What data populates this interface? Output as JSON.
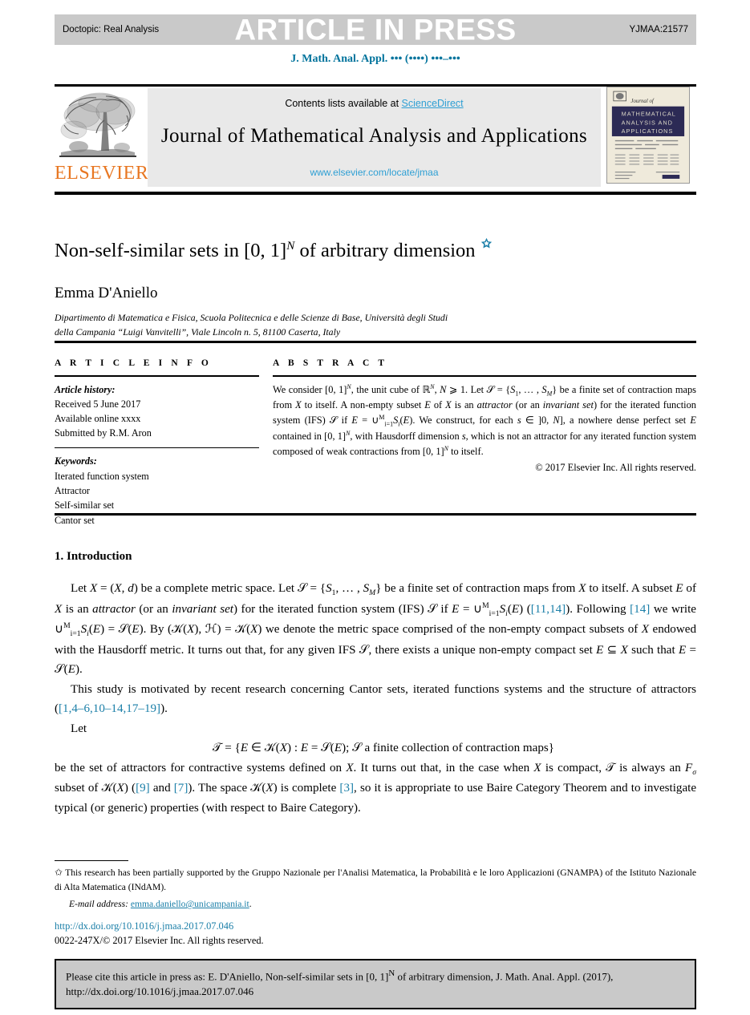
{
  "banner": {
    "doctopic": "Doctopic: Real Analysis",
    "watermark": "ARTICLE IN PRESS",
    "article_code": "YJMAA:21577",
    "running_head": "J. Math. Anal. Appl. ••• (••••) •••–•••"
  },
  "masthead": {
    "contents_prefix": "Contents lists available at ",
    "sciencedirect": "ScienceDirect",
    "journal_name": "Journal of Mathematical Analysis and Applications",
    "journal_url": "www.elsevier.com/locate/jmaa",
    "publisher_wordmark": "ELSEVIER",
    "cover_journal_of": "Journal of",
    "cover_title_line1": "MATHEMATICAL",
    "cover_title_line2": "ANALYSIS AND",
    "cover_title_line3": "APPLICATIONS"
  },
  "article": {
    "title_pre": "Non-self-similar sets in [0, 1]",
    "title_sup": "N",
    "title_post": " of arbitrary dimension",
    "star": "✩",
    "author": "Emma D'Aniello",
    "affiliation_line1": "Dipartimento di Matematica e Fisica, Scuola Politecnica e delle Scienze di Base, Università degli Studi",
    "affiliation_line2": "della Campania “Luigi Vanvitelli”, Viale Lincoln n. 5, 81100 Caserta, Italy"
  },
  "info": {
    "heading": "A R T I C L E    I N F O",
    "history_label": "Article history:",
    "history": [
      "Received 5 June 2017",
      "Available online xxxx",
      "Submitted by R.M. Aron"
    ],
    "keywords_label": "Keywords:",
    "keywords": [
      "Iterated function system",
      "Attractor",
      "Self-similar set",
      "Cantor set"
    ]
  },
  "abstract": {
    "heading": "A B S T R A C T",
    "body_html": "We consider [0, 1]<sup class=\"sm\"><i>N</i></sup>, the unit cube of ℝ<sup class=\"sm\"><i>N</i></sup>, <i>N</i> ⩾ 1. Let 𝒮 = {<i>S</i><sub class=\"sm\">1</sub>, … , <i>S<sub class=\"sm\">M</sub></i>} be a finite set of contraction maps from <i>X</i> to itself. A non-empty subset <i>E</i> of <i>X</i> is an <i>attractor</i> (or an <i>invariant set</i>) for the iterated function system (IFS) 𝒮 if <i>E</i> = ∪<sup class=\"sm\">M</sup><sub class=\"sm\">i=1</sub><i>S<sub class=\"sm\">i</sub></i>(<i>E</i>). We construct, for each <i>s</i> ∈ ]0, <i>N</i>], a nowhere dense perfect set <i>E</i> contained in [0, 1]<sup class=\"sm\"><i>N</i></sup>, with Hausdorff dimension <i>s</i>, which is not an attractor for any iterated function system composed of weak contractions from [0, 1]<sup class=\"sm\"><i>N</i></sup> to itself.",
    "copyright": "© 2017 Elsevier Inc. All rights reserved."
  },
  "section": {
    "number_title": "1. Introduction"
  },
  "body": {
    "p1_html": "Let <i>X</i> = (<i>X</i>, <i>d</i>) be a complete metric space. Let 𝒮 = {<i>S</i><sub class=\"sm\">1</sub>, … , <i>S<sub class=\"sm\">M</sub></i>} be a finite set of contraction maps from <i>X</i> to itself. A subset <i>E</i> of <i>X</i> is an <i>attractor</i> (or an <i>invariant set</i>) for the iterated function system (IFS) 𝒮 if <i>E</i> = ∪<sup class=\"sm\">M</sup><sub class=\"sm\">i=1</sub><i>S<sub class=\"sm\">i</sub></i>(<i>E</i>) (<span class=\"ref\">[11,14]</span>). Following <span class=\"ref\">[14]</span> we write ∪<sup class=\"sm\">M</sup><sub class=\"sm\">i=1</sub><i>S<sub class=\"sm\">i</sub></i>(<i>E</i>) = 𝒮(<i>E</i>). By (𝒦(<i>X</i>), ℋ) = 𝒦(<i>X</i>) we denote the metric space comprised of the non-empty compact subsets of <i>X</i> endowed with the Hausdorff metric. It turns out that, for any given IFS 𝒮, there exists a unique non-empty compact set <i>E</i> ⊆ <i>X</i> such that <i>E</i> = 𝒮(<i>E</i>).",
    "p2_html": "This study is motivated by recent research concerning Cantor sets, iterated functions systems and the structure of attractors (<span class=\"ref\">[1,4–6,10–14,17–19]</span>).",
    "p3_html": "Let",
    "equation_html": "𝒯 = {<i>E</i> ∈ 𝒦(<i>X</i>) : <i>E</i> = 𝒮(<i>E</i>); 𝒮 a finite collection of contraction maps}",
    "p4_html": "be the set of attractors for contractive systems defined on <i>X</i>. It turns out that, in the case when <i>X</i> is compact, 𝒯 is always an <i>F<sub class=\"sm\">σ</sub></i> subset of 𝒦(<i>X</i>) (<span class=\"ref\">[9]</span> and <span class=\"ref\">[7]</span>). The space 𝒦(<i>X</i>) is complete <span class=\"ref\">[3]</span>, so it is appropriate to use Baire Category Theorem and to investigate typical (or generic) properties (with respect to Baire Category)."
  },
  "footnote": {
    "star": "✩",
    "text": "This research has been partially supported by the Gruppo Nazionale per l'Analisi Matematica, la Probabilità e le loro Applicazioni (GNAMPA) of the Istituto Nazionale di Alta Matematica (INdAM).",
    "email_label": "E-mail address:",
    "email": "emma.daniello@unicampania.it",
    "doi_url": "http://dx.doi.org/10.1016/j.jmaa.2017.07.046",
    "issn_line": "0022-247X/© 2017 Elsevier Inc. All rights reserved."
  },
  "citation_box": {
    "text_pre": "Please cite this article in press as: E. D'Aniello, Non-self-similar sets in [0, 1]",
    "text_sup": "N",
    "text_post": " of arbitrary dimension, J. Math. Anal. Appl. (2017), http://dx.doi.org/10.1016/j.jmaa.2017.07.046"
  },
  "colors": {
    "link_blue": "#1b7fa8",
    "sciencedirect_blue": "#2e9fd4",
    "elsevier_orange": "#e87722",
    "banner_gray": "#c9c9c9",
    "contents_gray": "#e9e9e9",
    "cover_navy": "#2c2a55",
    "cover_cream": "#efeadb"
  }
}
